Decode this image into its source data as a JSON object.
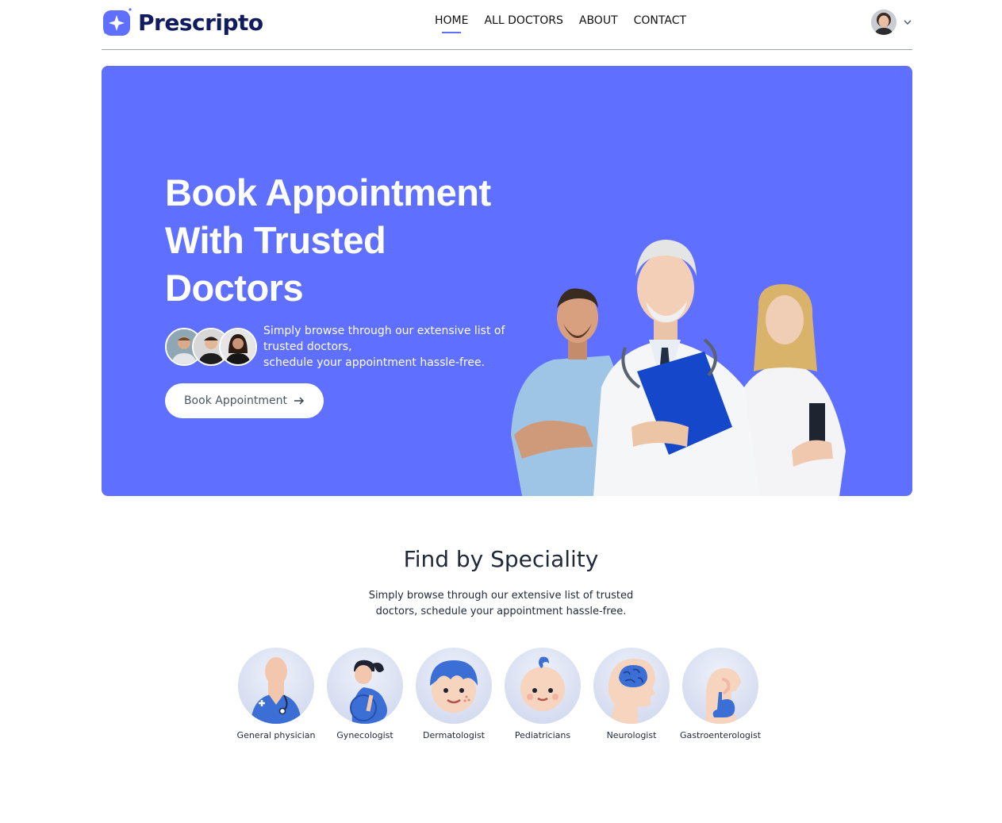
{
  "brand": {
    "name": "Prescripto",
    "accent": "#5f6fff",
    "dark": "#101c5e"
  },
  "nav": {
    "items": [
      {
        "label": "HOME",
        "active": true
      },
      {
        "label": "ALL DOCTORS",
        "active": false
      },
      {
        "label": "ABOUT",
        "active": false
      },
      {
        "label": "CONTACT",
        "active": false
      }
    ]
  },
  "profile": {
    "icon": "avatar",
    "menu_icon": "chevron-down-icon"
  },
  "hero": {
    "title_lines": [
      "Book Appointment",
      "With Trusted",
      "Doctors"
    ],
    "subtitle_lines": [
      "Simply browse through our extensive list of",
      "trusted doctors,",
      "schedule your appointment hassle-free."
    ],
    "button_label": "Book Appointment",
    "button_icon": "arrow-right-icon"
  },
  "speciality": {
    "title": "Find by Speciality",
    "subtitle_lines": [
      "Simply browse through our extensive list of trusted",
      "doctors, schedule your appointment hassle-free."
    ],
    "items": [
      {
        "label": "General physician",
        "icon": "general-physician-icon"
      },
      {
        "label": "Gynecologist",
        "icon": "gynecologist-icon"
      },
      {
        "label": "Dermatologist",
        "icon": "dermatologist-icon"
      },
      {
        "label": "Pediatricians",
        "icon": "pediatrician-icon"
      },
      {
        "label": "Neurologist",
        "icon": "neurologist-icon"
      },
      {
        "label": "Gastroenterologist",
        "icon": "gastroenterologist-icon"
      }
    ]
  }
}
